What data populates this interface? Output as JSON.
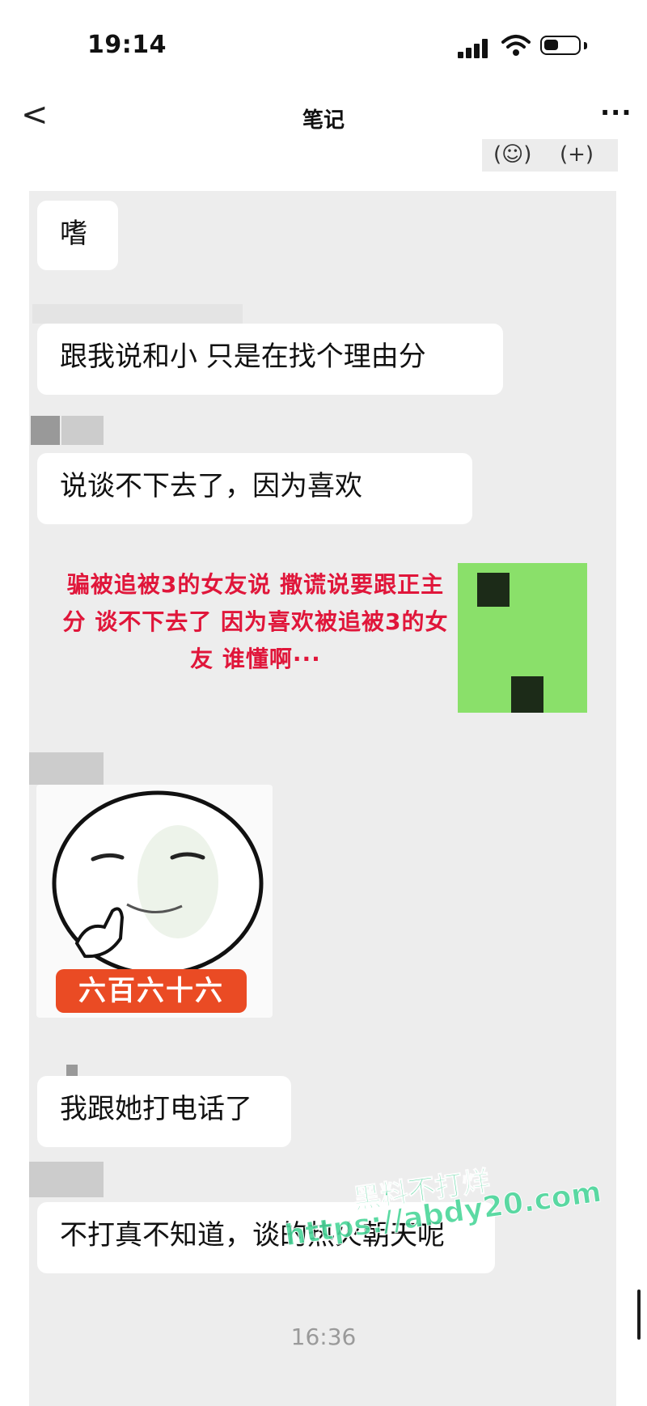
{
  "status_bar": {
    "time": "19:14"
  },
  "nav": {
    "back": "<",
    "title": "笔记",
    "more": "···"
  },
  "top_icons": {
    "emoji": "(☺)",
    "plus": "(+)"
  },
  "messages": [
    "嗜",
    "跟我说和小 只是在找个理由分",
    "说谈不下去了，因为喜欢",
    "我跟她打电话了",
    "不打真不知道，谈的热火朝天呢"
  ],
  "caption": {
    "line1": "骗被追被3的女友说 撒谎说要跟正主",
    "line2": "分 谈不下去了 因为喜欢被追被3的女",
    "line3": "友 谁懂啊···"
  },
  "sticker": {
    "badge": "六百六十六"
  },
  "watermark": {
    "line1": "黑料不打烊",
    "line2": "https://abdy20.com"
  },
  "timestamp": "16:36",
  "colors": {
    "caption_red": "#e0163a",
    "green_mask": "#8ae06a",
    "badge_orange": "#ea4b24",
    "chat_bg": "#ededed"
  }
}
